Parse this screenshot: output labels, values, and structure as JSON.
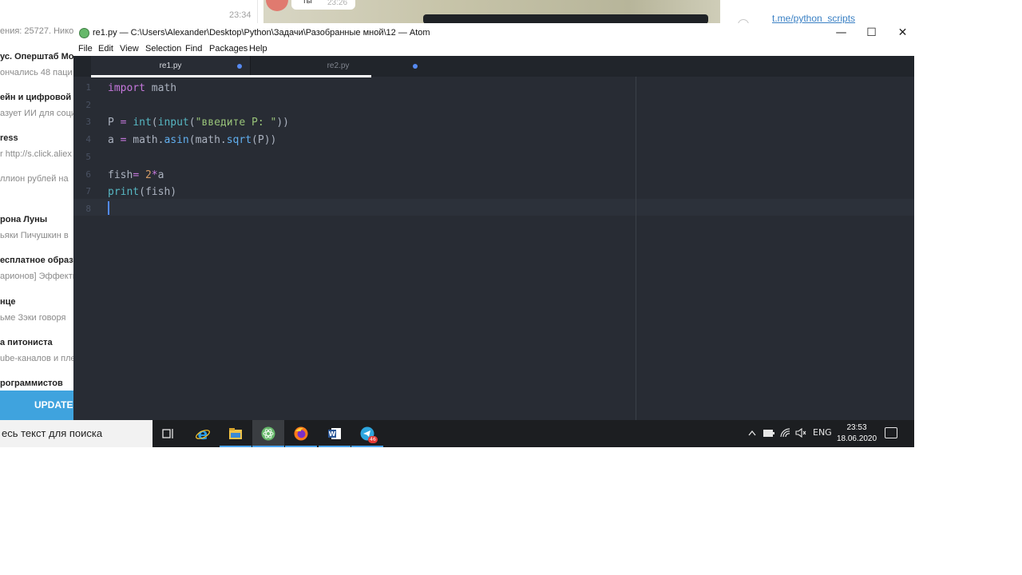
{
  "background": {
    "time": "23:34",
    "chats": [
      {
        "title": "",
        "preview": "ения: 25727. Нико"
      },
      {
        "title": "ус. Оперштаб Мо",
        "preview": "ончались 48 паци"
      },
      {
        "title": "ейн и цифровой",
        "preview": "азует ИИ для соци"
      },
      {
        "title": "ress",
        "preview": "r http://s.click.aliex"
      },
      {
        "title": "",
        "preview": "ллион рублей на"
      },
      {
        "title": "рона Луны",
        "preview": "ьяки Пичушкин в"
      },
      {
        "title": "есплатное образо",
        "preview": "арионов] Эффекты"
      },
      {
        "title": "нце",
        "preview": "ьме Зэки говоря"
      },
      {
        "title": "а питониста",
        "preview": "ube-каналов и пле"
      },
      {
        "title": "рограммистов",
        "preview": ""
      }
    ],
    "update_label": "UPDATE T",
    "bubble_time": "23:26",
    "bubble_text": "ты",
    "link_text": "t.me/python_scripts"
  },
  "window": {
    "title": "re1.py — C:\\Users\\Alexander\\Desktop\\Python\\Задачи\\Разобранные мной\\12 — Atom",
    "minimize": "—",
    "maximize": "☐",
    "close": "✕"
  },
  "menu": [
    "File",
    "Edit",
    "View",
    "Selection",
    "Find",
    "Packages",
    "Help"
  ],
  "tabs": [
    {
      "label": "re1.py",
      "active": true,
      "modified": true
    },
    {
      "label": "re2.py",
      "active": false,
      "modified": true
    }
  ],
  "editor": {
    "line_numbers": [
      "1",
      "2",
      "3",
      "4",
      "5",
      "6",
      "7",
      "8"
    ],
    "cursor_line": 8,
    "lines": [
      [
        {
          "t": "import",
          "c": "kw"
        },
        {
          "t": " math",
          "c": "pl"
        }
      ],
      [],
      [
        {
          "t": "P ",
          "c": "pl"
        },
        {
          "t": "=",
          "c": "op"
        },
        {
          "t": " ",
          "c": "pl"
        },
        {
          "t": "int",
          "c": "bn"
        },
        {
          "t": "(",
          "c": "pl"
        },
        {
          "t": "input",
          "c": "bn"
        },
        {
          "t": "(",
          "c": "pl"
        },
        {
          "t": "\"введите P: \"",
          "c": "st"
        },
        {
          "t": "))",
          "c": "pl"
        }
      ],
      [
        {
          "t": "a ",
          "c": "pl"
        },
        {
          "t": "=",
          "c": "op"
        },
        {
          "t": " math.",
          "c": "pl"
        },
        {
          "t": "asin",
          "c": "fn"
        },
        {
          "t": "(math.",
          "c": "pl"
        },
        {
          "t": "sqrt",
          "c": "fn"
        },
        {
          "t": "(P))",
          "c": "pl"
        }
      ],
      [],
      [
        {
          "t": "fish",
          "c": "pl"
        },
        {
          "t": "=",
          "c": "op"
        },
        {
          "t": " ",
          "c": "pl"
        },
        {
          "t": "2",
          "c": "nu"
        },
        {
          "t": "*",
          "c": "op"
        },
        {
          "t": "a",
          "c": "pl"
        }
      ],
      [
        {
          "t": "print",
          "c": "bn"
        },
        {
          "t": "(fish)",
          "c": "pl"
        }
      ],
      []
    ]
  },
  "taskbar": {
    "search_placeholder": "есь текст для поиска",
    "apps": [
      {
        "name": "task-view-icon",
        "active": false
      },
      {
        "name": "internet-explorer-icon",
        "active": false,
        "running": true
      },
      {
        "name": "file-explorer-icon",
        "active": false,
        "running": true
      },
      {
        "name": "atom-icon",
        "active": true,
        "running": true
      },
      {
        "name": "firefox-icon",
        "active": false,
        "running": true
      },
      {
        "name": "word-icon",
        "active": false,
        "running": true
      },
      {
        "name": "telegram-icon",
        "active": false,
        "running": true,
        "badge": "46"
      }
    ],
    "tray": {
      "language": "ENG",
      "time": "23:53",
      "date": "18.06.2020"
    }
  }
}
